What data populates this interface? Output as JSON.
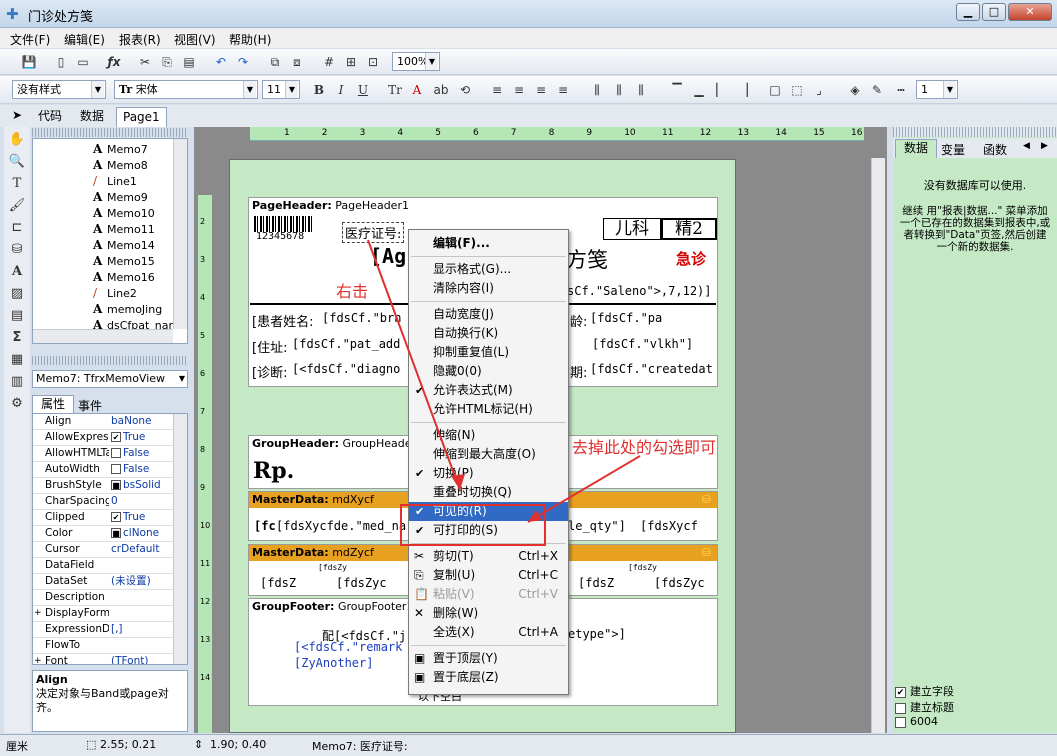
{
  "window": {
    "title": "门诊处方笺",
    "min_label": "▁",
    "max_label": "□",
    "close_label": "✕"
  },
  "menu": [
    "文件(F)",
    "编辑(E)",
    "报表(R)",
    "视图(V)",
    "帮助(H)"
  ],
  "toolbar1": {
    "zoom": "100%"
  },
  "toolbar2": {
    "style": "没有样式",
    "font": "宋体",
    "font_icon": "Tr",
    "size": "11",
    "frame_width": "1"
  },
  "tabs": [
    "代码",
    "数据",
    "Page1"
  ],
  "tree_items": [
    {
      "icon": "A",
      "label": "Memo7"
    },
    {
      "icon": "A",
      "label": "Memo8"
    },
    {
      "icon": "/",
      "label": "Line1"
    },
    {
      "icon": "A",
      "label": "Memo9"
    },
    {
      "icon": "A",
      "label": "Memo10"
    },
    {
      "icon": "A",
      "label": "Memo11"
    },
    {
      "icon": "A",
      "label": "Memo14"
    },
    {
      "icon": "A",
      "label": "Memo15"
    },
    {
      "icon": "A",
      "label": "Memo16"
    },
    {
      "icon": "/",
      "label": "Line2"
    },
    {
      "icon": "A",
      "label": "memoJing"
    },
    {
      "icon": "A",
      "label": "dsCfpat_nam"
    }
  ],
  "object_inspector": {
    "selected": "Memo7: TfrxMemoView",
    "tabs": [
      "属性",
      "事件"
    ],
    "rows": [
      {
        "name": "Align",
        "value": "baNone",
        "check": ""
      },
      {
        "name": "AllowExpress",
        "value": "True",
        "check": "✔"
      },
      {
        "name": "AllowHTMLTa",
        "value": "False",
        "check": " "
      },
      {
        "name": "AutoWidth",
        "value": "False",
        "check": " "
      },
      {
        "name": "BrushStyle",
        "value": "bsSolid",
        "check": "■"
      },
      {
        "name": "CharSpacing",
        "value": "0",
        "check": ""
      },
      {
        "name": "Clipped",
        "value": "True",
        "check": "✔"
      },
      {
        "name": "Color",
        "value": "clNone",
        "check": "■"
      },
      {
        "name": "Cursor",
        "value": "crDefault",
        "check": ""
      },
      {
        "name": "DataField",
        "value": "",
        "check": ""
      },
      {
        "name": "DataSet",
        "value": "(未设置)",
        "check": ""
      },
      {
        "name": "Description",
        "value": "",
        "check": ""
      },
      {
        "name": "DisplayForma",
        "value": "",
        "check": "",
        "expand": "+"
      },
      {
        "name": "ExpressionDe",
        "value": "[,]",
        "check": ""
      },
      {
        "name": "FlowTo",
        "value": "",
        "check": ""
      },
      {
        "name": "Font",
        "value": "(TFont)",
        "check": "",
        "expand": "+"
      }
    ],
    "help_title": "Align",
    "help_text": "决定对象与Band或page对齐。"
  },
  "ruler_ticks": [
    "1",
    "2",
    "3",
    "4",
    "5",
    "6",
    "7",
    "8",
    "9",
    "10",
    "11",
    "12",
    "13",
    "14",
    "15",
    "16"
  ],
  "left_ruler_ticks": [
    "2",
    "3",
    "4",
    "5",
    "6",
    "7",
    "8",
    "9",
    "10",
    "11",
    "12",
    "13",
    "14"
  ],
  "report": {
    "page_header": {
      "type": "PageHeader:",
      "name": "PageHeader1"
    },
    "barcode_text": "12345678",
    "medcard_label": "医疗证号:",
    "dept": "儿科",
    "jing": "精2",
    "title_part": "[Ag",
    "title_end": "方笺",
    "urgent": "急诊",
    "saleno_expr": "sCf.\"Saleno\">,7,12)]",
    "patient_label": "[患者姓名:",
    "patient_expr": "[fdsCf.\"brn",
    "age_label": "龄:",
    "age_expr": "[fdsCf.\"pa",
    "address_label": "[住址:",
    "address_expr": "[fdsCf.\"pat_add",
    "vlkh_expr": "[fdsCf.\"vlkh\"]",
    "diag_label": "[诊断:",
    "diag_expr": "[<fdsCf.\"diagno",
    "date_label": "期:",
    "date_expr": "[fdsCf.\"createdat",
    "group_header": {
      "type": "GroupHeader:",
      "name": "GroupHeader1"
    },
    "rp": "Rp.",
    "master1": {
      "type": "MasterData:",
      "name": "mdXycf"
    },
    "md1_a": "[fc",
    "md1_b": "[fdsXycfde.\"med_na",
    "md1_c": "le_qty\"]",
    "md1_d": "[fdsXycf",
    "master2": {
      "type": "MasterData:",
      "name": "mdZycf"
    },
    "md2_small": "[fdsZy",
    "md2_a": "[fdsZ",
    "md2_b": "[fdsZyc",
    "md2_c": "[fdsZ",
    "md2_d": "[fdsZyc",
    "group_footer": {
      "type": "GroupFooter:",
      "name": "GroupFooter1"
    },
    "gf_a": "配[<fdsCf.\"j",
    "gf_b": "etype\">]",
    "gf_remark": "[<fdsCf.\"remark",
    "gf_another": "[ZyAnother]",
    "gf_bottom": "以下空白"
  },
  "annotations": {
    "right_click": "右击",
    "uncheck": "去掉此处的勾选即可"
  },
  "context_menu": [
    {
      "label": "编辑(F)...",
      "bold": true,
      "sep_after": true
    },
    {
      "label": "显示格式(G)..."
    },
    {
      "label": "清除内容(I)",
      "sep_after": true
    },
    {
      "label": "自动宽度(J)"
    },
    {
      "label": "自动换行(K)"
    },
    {
      "label": "抑制重复值(L)"
    },
    {
      "label": "隐藏0(0)"
    },
    {
      "label": "允许表达式(M)",
      "check": "✔"
    },
    {
      "label": "允许HTML标记(H)",
      "sep_after": true
    },
    {
      "label": "伸缩(N)"
    },
    {
      "label": "伸缩到最大高度(O)"
    },
    {
      "label": "切换(P)",
      "check": "✔"
    },
    {
      "label": "重叠时切换(Q)"
    },
    {
      "label": "可见的(R)",
      "check": "✔",
      "selected": true
    },
    {
      "label": "可打印的(S)",
      "check": "✔",
      "sep_after": true
    },
    {
      "label": "剪切(T)",
      "shortcut": "Ctrl+X",
      "icon": "✂"
    },
    {
      "label": "复制(U)",
      "shortcut": "Ctrl+C",
      "icon": "⎘"
    },
    {
      "label": "粘贴(V)",
      "shortcut": "Ctrl+V",
      "icon": "📋",
      "disabled": true
    },
    {
      "label": "删除(W)",
      "icon": "✕"
    },
    {
      "label": "全选(X)",
      "shortcut": "Ctrl+A",
      "sep_after": true
    },
    {
      "label": "置于顶层(Y)",
      "icon": "▣"
    },
    {
      "label": "置于底层(Z)",
      "icon": "▣"
    }
  ],
  "right_panel": {
    "tabs": [
      "数据",
      "变量",
      "函数"
    ],
    "msg1": "没有数据库可以使用.",
    "msg2": "继续 用\"报表|数据...\" 菜单添加一个已存在的数据集到报表中,或者转换到\"Data\"页签,然后创建一个新的数据集.",
    "options": [
      {
        "label": "建立字段",
        "checked": "✔"
      },
      {
        "label": "建立标题",
        "checked": ""
      },
      {
        "label": "6004",
        "checked": ""
      }
    ]
  },
  "status": {
    "unit": "厘米",
    "pos": "2.55; 0.21",
    "size": "1.90; 0.40",
    "object": "Memo7: 医疗证号:"
  },
  "colors": {
    "accent": "#316ac5",
    "annotation": "#e03030",
    "band_yellow": "#e8a020",
    "page_green": "#c4e9c4"
  }
}
